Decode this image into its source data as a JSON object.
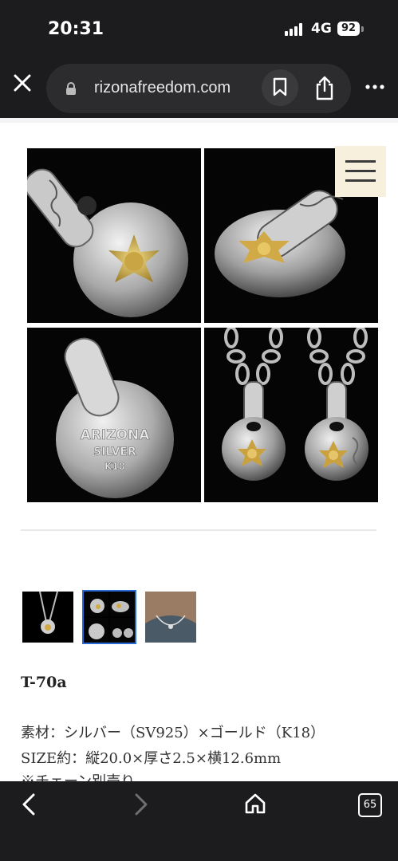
{
  "status": {
    "time": "20:31",
    "network": "4G",
    "battery": "92"
  },
  "browser": {
    "url": "rizonafreedom.com",
    "tab_count": "65"
  },
  "product": {
    "code": "T-70a",
    "material": "素材：シルバー（SV925）×ゴールド（K18）",
    "size": "SIZE約：縦20.0×厚さ2.5×横12.6mm",
    "note": "※チェーン別売り"
  },
  "engraving": {
    "line1": "ARIZONA",
    "line2": "SILVER",
    "line3": "K18"
  },
  "icons": [
    "close-icon",
    "lock-icon",
    "bookmark-icon",
    "share-icon",
    "more-icon",
    "menu-icon",
    "back-icon",
    "forward-icon",
    "home-icon",
    "tabs-icon"
  ],
  "colors": {
    "chrome": "#1c1c1e",
    "menu_bg": "#f7f0dc",
    "selected_outline": "#2a6bd6"
  }
}
